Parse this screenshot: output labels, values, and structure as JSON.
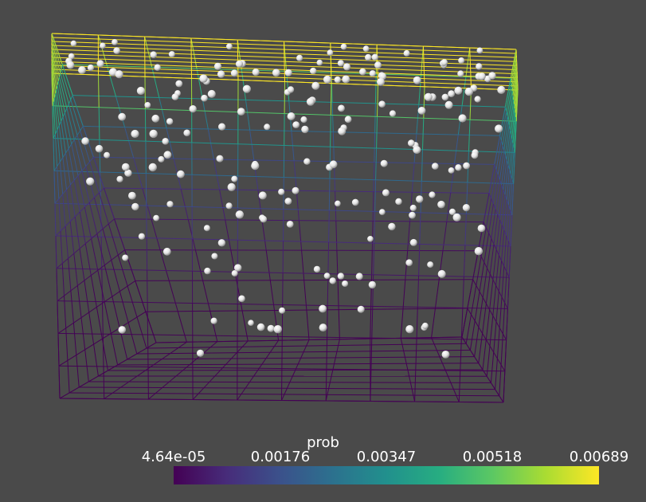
{
  "scalar_bar": {
    "title": "prob",
    "ticks": [
      "4.64e-05",
      "0.00176",
      "0.00347",
      "0.00518",
      "0.00689"
    ],
    "range": [
      4.64e-05,
      0.00689
    ],
    "colormap": [
      "#440154",
      "#472c7a",
      "#3b518b",
      "#2c718e",
      "#21908d",
      "#27ad81",
      "#5cc863",
      "#aadc32",
      "#fde725"
    ]
  },
  "colors": {
    "background": "#4a4a4a",
    "sphere": "#e9e9e9"
  },
  "scene": {
    "grid_divisions": 10,
    "sphere_count": 200
  }
}
